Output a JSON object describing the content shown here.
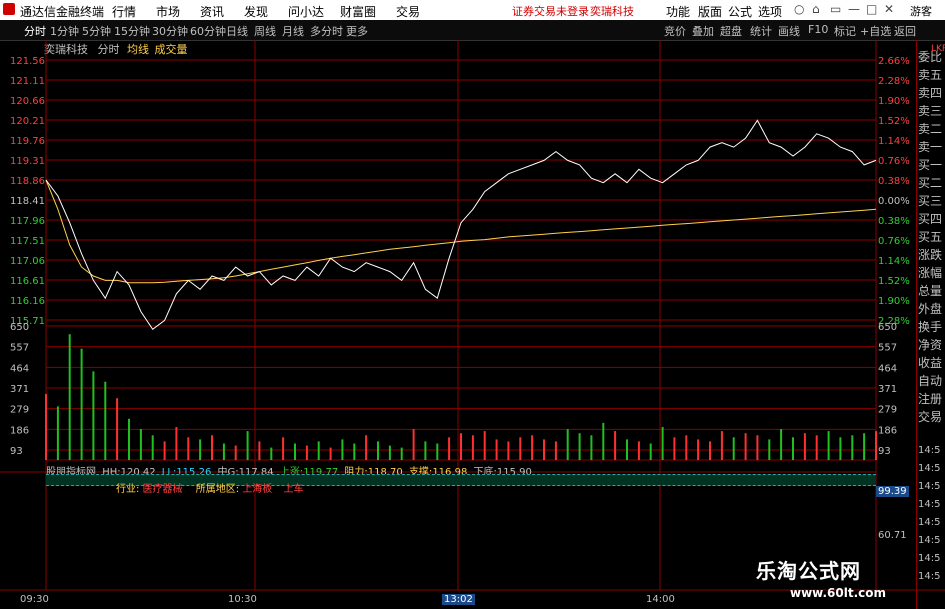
{
  "app": {
    "title": "通达信金融终端",
    "menu": [
      "行情",
      "市场",
      "资讯",
      "发现",
      "问小达",
      "财富圈",
      "交易"
    ],
    "notice": "证券交易未登录",
    "stock_name": "奕瑞科技",
    "right_menu": [
      "功能",
      "版面",
      "公式",
      "选项"
    ],
    "guest": "游客",
    "controls": [
      "○",
      "⌂",
      "▭",
      "—",
      "□",
      "✕"
    ]
  },
  "toolbar": {
    "periods": [
      "分时",
      "1分钟",
      "5分钟",
      "15分钟",
      "30分钟",
      "60分钟",
      "日线",
      "周线",
      "月线",
      "多分时",
      "更多"
    ],
    "active_period": "分时",
    "right_buttons": [
      "竞价",
      "叠加",
      "超盘",
      "统计",
      "画线",
      "F10",
      "标记",
      "+自选",
      "返回"
    ]
  },
  "chart_title": {
    "name": "奕瑞科技",
    "view": "分时",
    "avg_label": "均线",
    "vol_label": "成交量"
  },
  "price_axis": [
    "121.56",
    "121.11",
    "120.66",
    "120.21",
    "119.76",
    "119.31",
    "118.86",
    "118.41",
    "117.96",
    "117.51",
    "117.06",
    "116.61",
    "116.16",
    "115.71"
  ],
  "pct_axis": [
    "2.66%",
    "2.28%",
    "1.90%",
    "1.52%",
    "1.14%",
    "0.76%",
    "0.38%",
    "0.00%",
    "0.38%",
    "0.76%",
    "1.14%",
    "1.52%",
    "1.90%",
    "2.28%"
  ],
  "vol_axis": [
    "650",
    "557",
    "464",
    "371",
    "279",
    "186",
    "93"
  ],
  "time_axis": [
    "09:30",
    "10:30",
    "13:02",
    "14:00"
  ],
  "indicator": {
    "header": "股朋指标网",
    "hh_label": "HH:",
    "hh": "120.42",
    "ll_label": "LL:",
    "ll": "115.26",
    "mid_label": "中G:",
    "mid": "117.84",
    "up_label": "上涨:",
    "up": "119.77",
    "res_label": "阻力:",
    "res": "118.70",
    "sup_label": "支撑:",
    "sup": "116.98",
    "down_label": "下底:",
    "down": "115.90",
    "row_label": "行业:",
    "row_value": "医疗器械",
    "region_label": "所属地区:",
    "region_value": "上海板",
    "car_label": "上车",
    "axis_top": "99.39",
    "axis_bottom": "60.71"
  },
  "side_panel": {
    "code_hint": "LKR",
    "labels": [
      "委比",
      "卖五",
      "卖四",
      "卖三",
      "卖二",
      "卖一",
      "买一",
      "买二",
      "买三",
      "买四",
      "买五",
      "涨跌",
      "涨幅",
      "总量",
      "外盘",
      "换手",
      "净资",
      "收益",
      "自动",
      "注册",
      "交易"
    ],
    "times": [
      "14:5",
      "14:5",
      "14:5",
      "14:5",
      "14:5",
      "14:5",
      "14:5",
      "14:5"
    ]
  },
  "watermark": {
    "line1": "乐淘公式网",
    "line2": "www.60lt.com"
  },
  "colors": {
    "grid": "#8a0000",
    "price": "#ffffff",
    "avg": "#ffd24a",
    "up_bar": "#ff3030",
    "down_bar": "#20c020",
    "axis_up": "#ff4040",
    "axis_down": "#30d030"
  },
  "chart_data": {
    "type": "line",
    "price": [
      118.86,
      118.5,
      117.9,
      117.2,
      116.6,
      116.2,
      116.8,
      116.5,
      115.9,
      115.5,
      115.7,
      116.3,
      116.6,
      116.4,
      116.7,
      116.6,
      116.9,
      116.7,
      116.8,
      116.5,
      116.7,
      116.6,
      116.9,
      116.7,
      117.1,
      116.9,
      116.8,
      117.0,
      116.9,
      116.8,
      116.6,
      117.0,
      116.4,
      116.2,
      117.1,
      117.9,
      118.2,
      118.6,
      118.8,
      119.0,
      119.1,
      119.2,
      119.3,
      119.5,
      119.3,
      119.2,
      118.9,
      118.8,
      119.0,
      118.8,
      119.1,
      118.9,
      118.8,
      119.0,
      119.2,
      119.3,
      119.6,
      119.7,
      119.6,
      119.8,
      120.2,
      119.7,
      119.6,
      119.4,
      119.6,
      119.9,
      119.8,
      119.6,
      119.5,
      119.2,
      119.3
    ],
    "avg": [
      118.86,
      118.2,
      117.4,
      116.9,
      116.7,
      116.6,
      116.6,
      116.55,
      116.55,
      116.55,
      116.56,
      116.58,
      116.6,
      116.62,
      116.64,
      116.66,
      116.7,
      116.75,
      116.8,
      116.85,
      116.9,
      116.95,
      117.0,
      117.05,
      117.1,
      117.14,
      117.18,
      117.22,
      117.26,
      117.3,
      117.33,
      117.36,
      117.39,
      117.42,
      117.45,
      117.48,
      117.5,
      117.52,
      117.55,
      117.58,
      117.6,
      117.62,
      117.64,
      117.66,
      117.68,
      117.7,
      117.72,
      117.74,
      117.76,
      117.78,
      117.8,
      117.82,
      117.84,
      117.86,
      117.88,
      117.9,
      117.92,
      117.94,
      117.96,
      117.98,
      118.0,
      118.02,
      118.04,
      118.06,
      118.08,
      118.1,
      118.12,
      118.14,
      118.16,
      118.18,
      118.2
    ],
    "volume": [
      320,
      260,
      610,
      540,
      430,
      380,
      300,
      200,
      150,
      120,
      90,
      160,
      110,
      100,
      120,
      80,
      70,
      140,
      90,
      60,
      110,
      80,
      70,
      90,
      60,
      100,
      80,
      120,
      90,
      70,
      60,
      150,
      90,
      80,
      110,
      130,
      120,
      140,
      100,
      90,
      110,
      120,
      100,
      90,
      150,
      130,
      120,
      180,
      140,
      100,
      90,
      80,
      160,
      110,
      120,
      100,
      90,
      140,
      110,
      130,
      120,
      100,
      150,
      110,
      130,
      120,
      140,
      110,
      120,
      130,
      140
    ],
    "y_range": [
      115.71,
      121.56
    ],
    "prev_close": 118.41,
    "vol_range": [
      0,
      650
    ]
  }
}
